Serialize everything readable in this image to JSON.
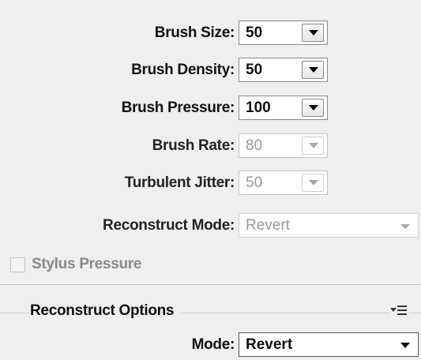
{
  "controls": [
    {
      "label": "Brush Size:",
      "value": "50",
      "enabled": true
    },
    {
      "label": "Brush Density:",
      "value": "50",
      "enabled": true
    },
    {
      "label": "Brush Pressure:",
      "value": "100",
      "enabled": true
    },
    {
      "label": "Brush Rate:",
      "value": "80",
      "enabled": false
    },
    {
      "label": "Turbulent Jitter:",
      "value": "50",
      "enabled": false
    }
  ],
  "reconstruct_mode": {
    "label": "Reconstruct Mode:",
    "value": "Revert",
    "enabled": false
  },
  "stylus": {
    "label": "Stylus Pressure",
    "checked": false,
    "enabled": false
  },
  "reconstruct_options": {
    "title": "Reconstruct Options",
    "menu_icon": "panel-menu-icon",
    "mode_label": "Mode:",
    "mode_value": "Revert"
  }
}
